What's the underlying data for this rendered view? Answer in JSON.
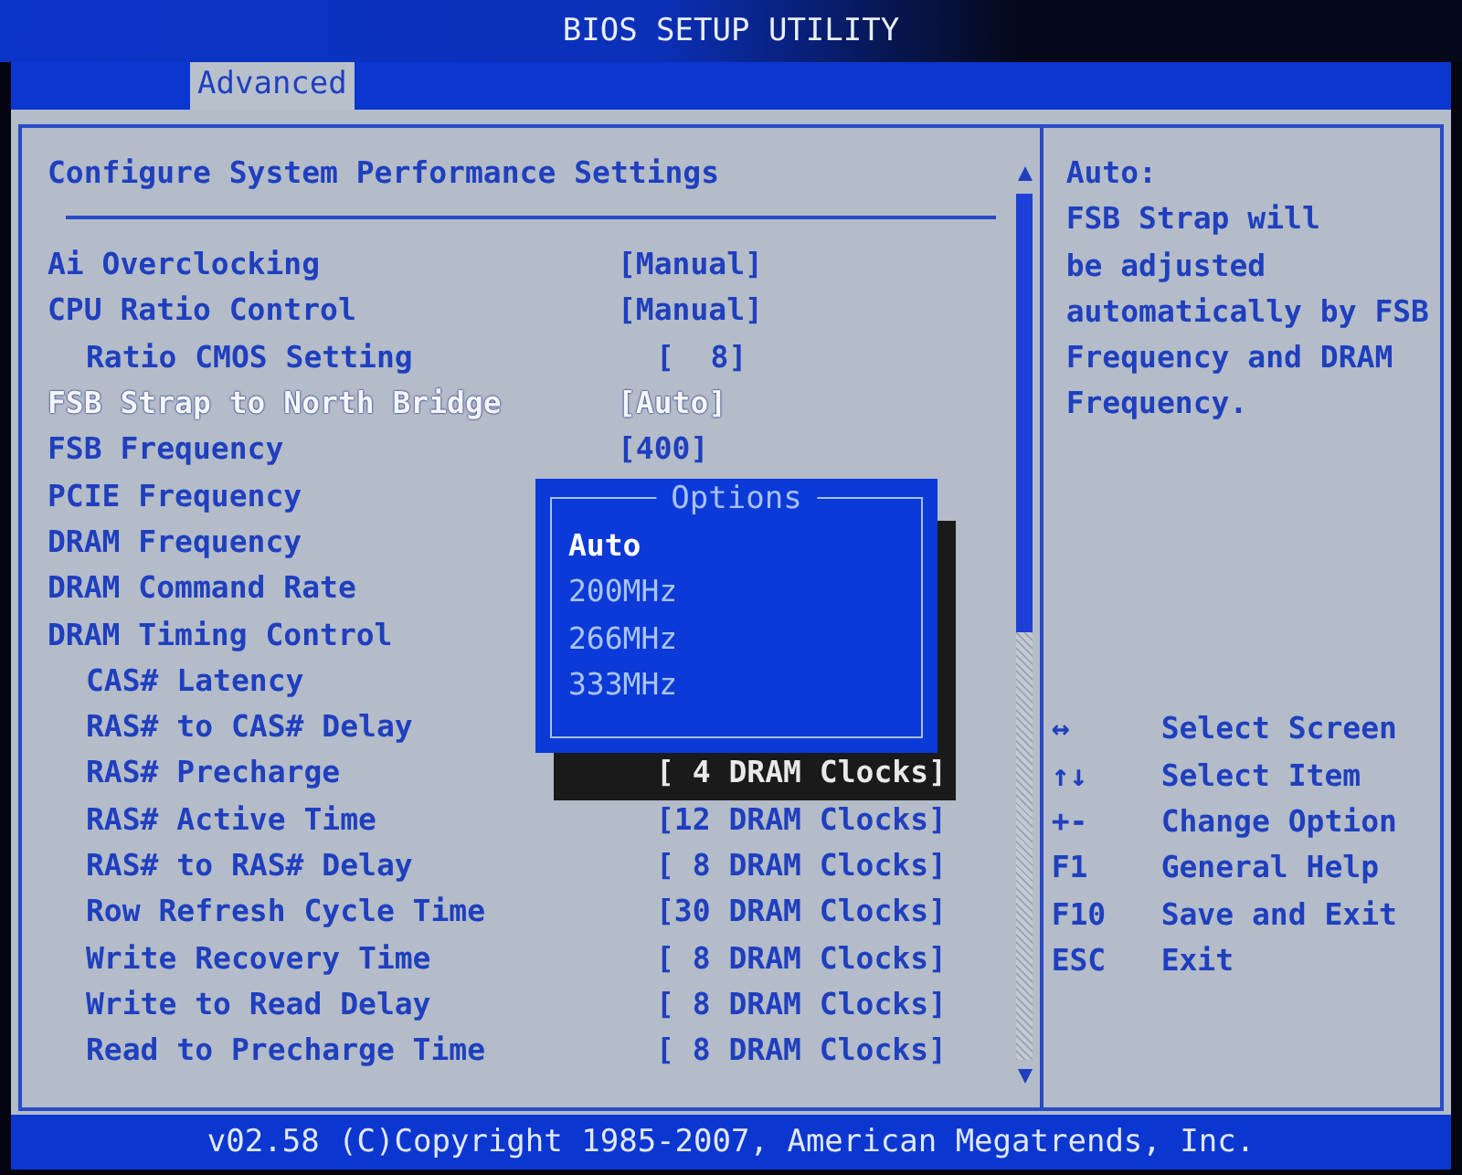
{
  "title": "BIOS SETUP UTILITY",
  "tabs": [
    {
      "label": "Advanced",
      "selected": true
    }
  ],
  "heading": "Configure System Performance Settings",
  "settings": [
    {
      "label": "Ai Overclocking",
      "value": "[Manual]",
      "selected": false
    },
    {
      "label": "CPU Ratio Control",
      "value": "[Manual]",
      "selected": false,
      "children": [
        {
          "label": "Ratio CMOS Setting",
          "value": "[  8]",
          "selected": false
        }
      ]
    },
    {
      "label": "FSB Strap to North Bridge",
      "value": "[Auto]",
      "selected": true
    },
    {
      "label": "FSB Frequency",
      "value": "[400]",
      "selected": false
    },
    {
      "label": "PCIE Frequency",
      "selected": false
    },
    {
      "label": "DRAM Frequency",
      "selected": false
    },
    {
      "label": "DRAM Command Rate",
      "selected": false
    },
    {
      "label": "DRAM Timing Control",
      "selected": false,
      "children": [
        {
          "label": "CAS# Latency",
          "selected": false
        },
        {
          "label": "RAS# to CAS# Delay",
          "selected": false
        },
        {
          "label": "RAS# Precharge",
          "value": "[ 4 DRAM Clocks]",
          "selected": false
        },
        {
          "label": "RAS# Active Time",
          "value": "[12 DRAM Clocks]",
          "selected": false
        },
        {
          "label": "RAS# to RAS# Delay",
          "value": "[ 8 DRAM Clocks]",
          "selected": false
        },
        {
          "label": "Row Refresh Cycle Time",
          "value": "[30 DRAM Clocks]",
          "selected": false
        },
        {
          "label": "Write Recovery Time",
          "value": "[ 8 DRAM Clocks]",
          "selected": false
        },
        {
          "label": "Write to Read Delay",
          "value": "[ 8 DRAM Clocks]",
          "selected": false
        },
        {
          "label": "Read to Precharge Time",
          "value": "[ 8 DRAM Clocks]",
          "selected": false
        }
      ]
    }
  ],
  "options_popup": {
    "title": "Options",
    "items": [
      {
        "label": "Auto",
        "selected": true
      },
      {
        "label": "200MHz",
        "selected": false
      },
      {
        "label": "266MHz",
        "selected": false
      },
      {
        "label": "333MHz",
        "selected": false
      }
    ]
  },
  "help": [
    "Auto:",
    "FSB Strap will",
    "be adjusted",
    "automatically by FSB",
    "Frequency and DRAM",
    "Frequency."
  ],
  "keys": [
    {
      "key": "↔",
      "action": "Select Screen"
    },
    {
      "key": "↑↓",
      "action": "Select Item"
    },
    {
      "key": "+-",
      "action": "Change Option"
    },
    {
      "key": "F1",
      "action": "General Help"
    },
    {
      "key": "F10",
      "action": "Save and Exit"
    },
    {
      "key": "ESC",
      "action": "Exit"
    }
  ],
  "footer": "v02.58 (C)Copyright 1985-2007, American Megatrends, Inc."
}
